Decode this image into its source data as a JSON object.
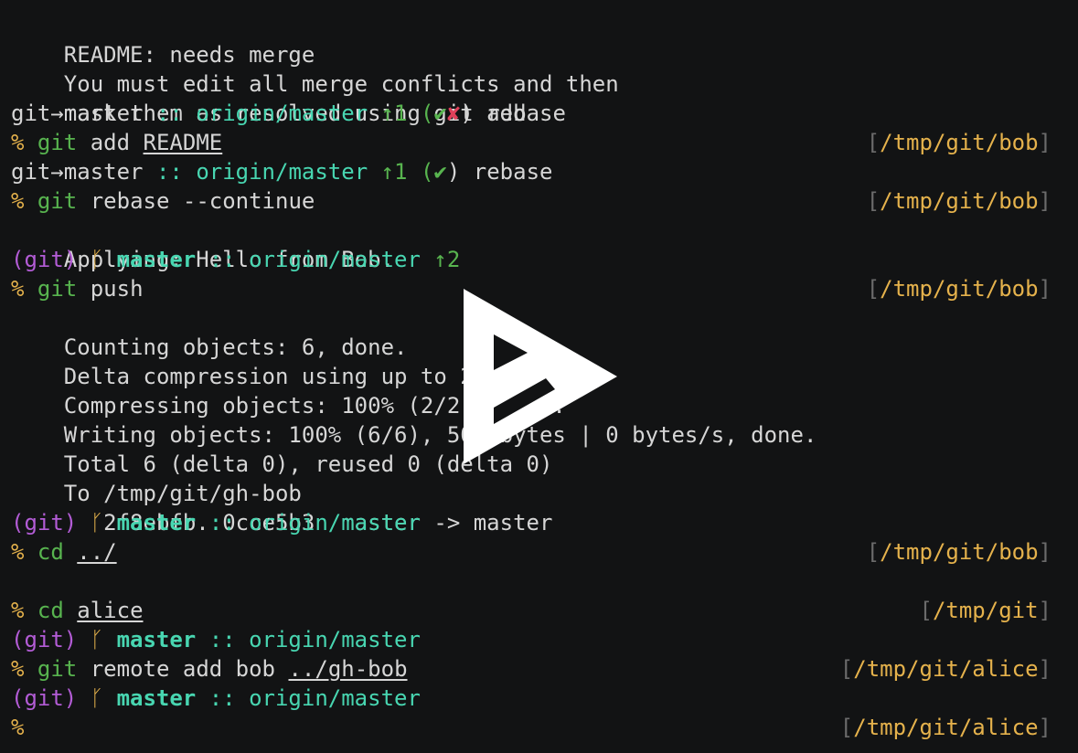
{
  "lines": [
    {
      "text": "README: needs merge"
    },
    {
      "text": "You must edit all merge conflicts and then"
    },
    {
      "text": "mark them as resolved using git add"
    },
    {
      "branch": "git→master",
      "sep": "::",
      "remote": "origin/master",
      "ahead": "↑1",
      "status_open": "(",
      "check": "✔",
      "cross": "✘",
      "status_close": ")",
      "state": "rebase"
    },
    {
      "prompt": "%",
      "cmd": "git",
      "args": "add",
      "arg_u": "README",
      "cwd": "/tmp/git/bob"
    },
    {
      "branch": "git→master",
      "sep": "::",
      "remote": "origin/master",
      "ahead": "↑1",
      "status_open": "(",
      "check": "✔",
      "status_close": ")",
      "state": "rebase"
    },
    {
      "prompt": "%",
      "cmd": "git",
      "args": "rebase --continue",
      "cwd": "/tmp/git/bob"
    },
    {
      "text": "Applying: Hello from Bob."
    },
    {
      "vcs": "(git)",
      "branch_icon": "ᚴ",
      "branch": "master",
      "sep": "::",
      "remote": "origin/master",
      "ahead": "↑2"
    },
    {
      "prompt": "%",
      "cmd": "git",
      "args": "push",
      "cwd": "/tmp/git/bob"
    },
    {
      "text": "Counting objects: 6, done."
    },
    {
      "text": "Delta compression using up to 2 threads."
    },
    {
      "text": "Compressing objects: 100% (2/2), done."
    },
    {
      "text": "Writing objects: 100% (6/6), 506 bytes | 0 bytes/s, done."
    },
    {
      "text": "Total 6 (delta 0), reused 0 (delta 0)"
    },
    {
      "text": "To /tmp/git/gh-bob"
    },
    {
      "text": "   2f8ebfb..0cce5b3  master -> master"
    },
    {
      "vcs": "(git)",
      "branch_icon": "ᚴ",
      "branch": "master",
      "sep": "::",
      "remote": "origin/master"
    },
    {
      "prompt": "%",
      "cmd": "cd",
      "arg_u": "../",
      "cwd": "/tmp/git/bob"
    },
    {
      "text": ""
    },
    {
      "prompt": "%",
      "cmd": "cd",
      "arg_u": "alice",
      "cwd": "/tmp/git"
    },
    {
      "vcs": "(git)",
      "branch_icon": "ᚴ",
      "branch": "master",
      "sep": "::",
      "remote": "origin/master"
    },
    {
      "prompt": "%",
      "cmd": "git",
      "args": "remote add bob",
      "arg_u": "../gh-bob",
      "cwd": "/tmp/git/alice"
    },
    {
      "vcs": "(git)",
      "branch_icon": "ᚴ",
      "branch": "master",
      "sep": "::",
      "remote": "origin/master"
    },
    {
      "prompt": "%",
      "cwd": "/tmp/git/alice"
    }
  ],
  "colors": {
    "background": "#121314",
    "text": "#d6d6d6",
    "prompt": "#e5b24c",
    "command": "#58b44f",
    "remote": "#48d6b1",
    "vcs": "#b35cd6",
    "cross": "#e0405a",
    "bracket": "#6b6b6b"
  },
  "overlay": {
    "icon": "play-icon"
  }
}
